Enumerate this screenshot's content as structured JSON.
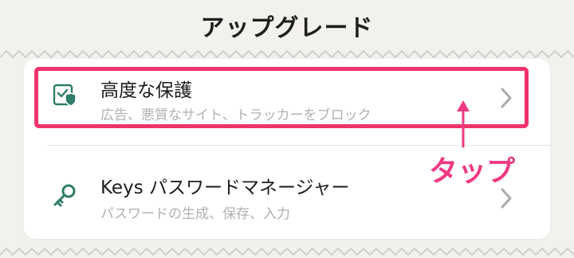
{
  "header": {
    "title": "アップグレード"
  },
  "items": [
    {
      "title": "高度な保護",
      "subtitle": "広告、悪質なサイト、トラッカーをブロック",
      "icon": "shield-check-icon"
    },
    {
      "title": "Keys パスワードマネージャー",
      "subtitle": "パスワードの生成、保存、入力",
      "icon": "key-icon"
    }
  ],
  "annotation": {
    "label": "タップ"
  },
  "colors": {
    "accent": "#2e7d68",
    "highlight": "#f0336c",
    "annotation_text": "#ee3a83",
    "background": "#f3f1ec"
  }
}
